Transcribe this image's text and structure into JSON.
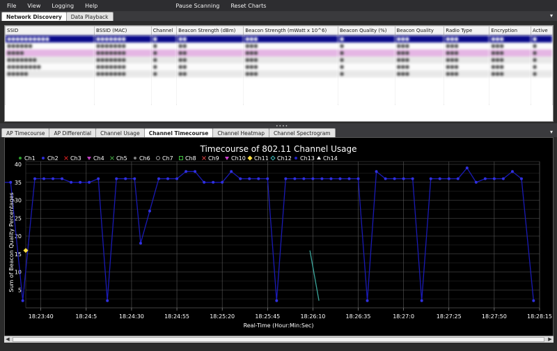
{
  "menu": {
    "items": [
      "File",
      "View",
      "Logging",
      "Help"
    ],
    "actions": [
      "Pause Scanning",
      "Reset Charts"
    ]
  },
  "top_tabs": [
    {
      "label": "Network Discovery",
      "active": true
    },
    {
      "label": "Data Playback",
      "active": false
    }
  ],
  "network_table": {
    "columns": [
      "SSID",
      "BSSID (MAC)",
      "Channel",
      "Beacon Strength (dBm)",
      "Beacon Strength (mWatt x 10^6)",
      "Beacon Quality (%)",
      "Beacon Quality",
      "Radio Type",
      "Encryption",
      "Active"
    ]
  },
  "bottom_tabs": [
    {
      "label": "AP Timecourse",
      "active": false
    },
    {
      "label": "AP Differential",
      "active": false
    },
    {
      "label": "Channel Usage",
      "active": false
    },
    {
      "label": "Channel Timecourse",
      "active": true
    },
    {
      "label": "Channel Heatmap",
      "active": false
    },
    {
      "label": "Channel Spectrogram",
      "active": false
    }
  ],
  "chart_data": {
    "type": "line",
    "title": "Timecourse of 802.11 Channel Usage",
    "xlabel": "Real-Time (Hour:Min:Sec)",
    "ylabel": "Sum of Beacon Quality Percentages",
    "ylim": [
      0,
      40
    ],
    "yticks": [
      5,
      10,
      15,
      20,
      25,
      30,
      35,
      40
    ],
    "xlim_seconds": [
      18375,
      18545
    ],
    "xtick_labels": [
      "18:23:40",
      "18:24:5",
      "18:24:30",
      "18:24:55",
      "18:25:20",
      "18:25:45",
      "18:26:10",
      "18:26:35",
      "18:27:0",
      "18:27:25",
      "18:27:50",
      "18:28:15"
    ],
    "xtick_seconds": [
      18380,
      18395,
      18410,
      18425,
      18440,
      18455,
      18470,
      18485,
      18500,
      18515,
      18530,
      18545
    ],
    "grid": true,
    "legend_position": "top",
    "legend": [
      {
        "name": "Ch1",
        "color": "#2e9e2e",
        "marker": "dot"
      },
      {
        "name": "Ch2",
        "color": "#2b2bd6",
        "marker": "dot"
      },
      {
        "name": "Ch3",
        "color": "#d02020",
        "marker": "cross"
      },
      {
        "name": "Ch4",
        "color": "#c040c0",
        "marker": "triangle-down"
      },
      {
        "name": "Ch5",
        "color": "#40a040",
        "marker": "x"
      },
      {
        "name": "Ch6",
        "color": "#808080",
        "marker": "dot"
      },
      {
        "name": "Ch7",
        "color": "#a0a0a0",
        "marker": "circle"
      },
      {
        "name": "Ch8",
        "color": "#40c040",
        "marker": "square"
      },
      {
        "name": "Ch9",
        "color": "#d04040",
        "marker": "star"
      },
      {
        "name": "Ch10",
        "color": "#d040d0",
        "marker": "triangle-down"
      },
      {
        "name": "Ch11",
        "color": "#ffe040",
        "marker": "diamond"
      },
      {
        "name": "Ch12",
        "color": "#40c0c0",
        "marker": "diamond-open"
      },
      {
        "name": "Ch13",
        "color": "#2020c0",
        "marker": "dot"
      },
      {
        "name": "Ch14",
        "color": "#f0f0f0",
        "marker": "triangle"
      }
    ],
    "series": [
      {
        "name": "Ch2",
        "color": "#1a1ab5",
        "x": [
          18366,
          18370,
          18374,
          18378,
          18381,
          18384,
          18387,
          18390,
          18393,
          18396,
          18399,
          18402,
          18405,
          18408,
          18411,
          18413,
          18416,
          18419,
          18422,
          18425,
          18428,
          18431,
          18434,
          18437,
          18440,
          18443,
          18446,
          18449,
          18452,
          18455,
          18458,
          18461,
          18464,
          18467,
          18470,
          18473,
          18476,
          18479,
          18482,
          18485,
          18488,
          18491,
          18494,
          18497,
          18500,
          18503,
          18506,
          18509,
          18512,
          18515,
          18518,
          18521,
          18524,
          18527,
          18530,
          18533,
          18536,
          18539,
          18543
        ],
        "y": [
          35,
          35,
          2,
          36,
          36,
          36,
          36,
          35,
          35,
          35,
          36,
          2,
          36,
          36,
          36,
          18,
          27,
          36,
          36,
          36,
          38,
          38,
          35,
          35,
          35,
          38,
          36,
          36,
          36,
          36,
          2,
          36,
          36,
          36,
          36,
          36,
          36,
          36,
          36,
          36,
          2,
          38,
          36,
          36,
          36,
          36,
          2,
          36,
          36,
          36,
          36,
          39,
          35,
          36,
          36,
          36,
          38,
          36,
          2
        ]
      },
      {
        "name": "Ch12",
        "color": "#3aa59a",
        "x": [
          18469,
          18472
        ],
        "y": [
          16,
          2
        ]
      },
      {
        "name": "Ch11",
        "color": "#ffe040",
        "x": [
          18375
        ],
        "y": [
          16
        ]
      }
    ]
  }
}
